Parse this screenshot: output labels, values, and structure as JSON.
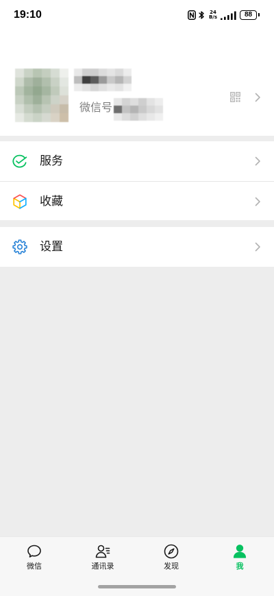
{
  "status_bar": {
    "time": "19:10",
    "net_speed_value": "24",
    "net_speed_unit": "B/s",
    "battery_level": "88",
    "icons": {
      "nfc": "nfc-icon",
      "bluetooth": "bluetooth-icon",
      "signal": "signal-icon",
      "battery": "battery-icon"
    }
  },
  "profile": {
    "wechat_id_label": "微信号",
    "qr_icon": "qr-code-icon",
    "chevron_icon": "chevron-right-icon"
  },
  "menu": {
    "groups": [
      {
        "items": [
          {
            "label": "服务",
            "icon": "services-icon"
          },
          {
            "label": "收藏",
            "icon": "favorites-icon"
          }
        ]
      },
      {
        "items": [
          {
            "label": "设置",
            "icon": "settings-icon"
          }
        ]
      }
    ]
  },
  "tab_bar": {
    "tabs": [
      {
        "label": "微信",
        "icon": "chats-icon",
        "active": false
      },
      {
        "label": "通讯录",
        "icon": "contacts-icon",
        "active": false
      },
      {
        "label": "发现",
        "icon": "discover-icon",
        "active": false
      },
      {
        "label": "我",
        "icon": "me-icon",
        "active": true
      }
    ]
  },
  "colors": {
    "accent": "#07c160",
    "background": "#ededed",
    "surface": "#ffffff",
    "tab_bar": "#f7f7f7",
    "text_primary": "#191919",
    "text_secondary": "#7f7f7f",
    "chevron": "#b2b2b2",
    "settings_icon": "#2782d7",
    "divider": "#e5e5e5"
  }
}
